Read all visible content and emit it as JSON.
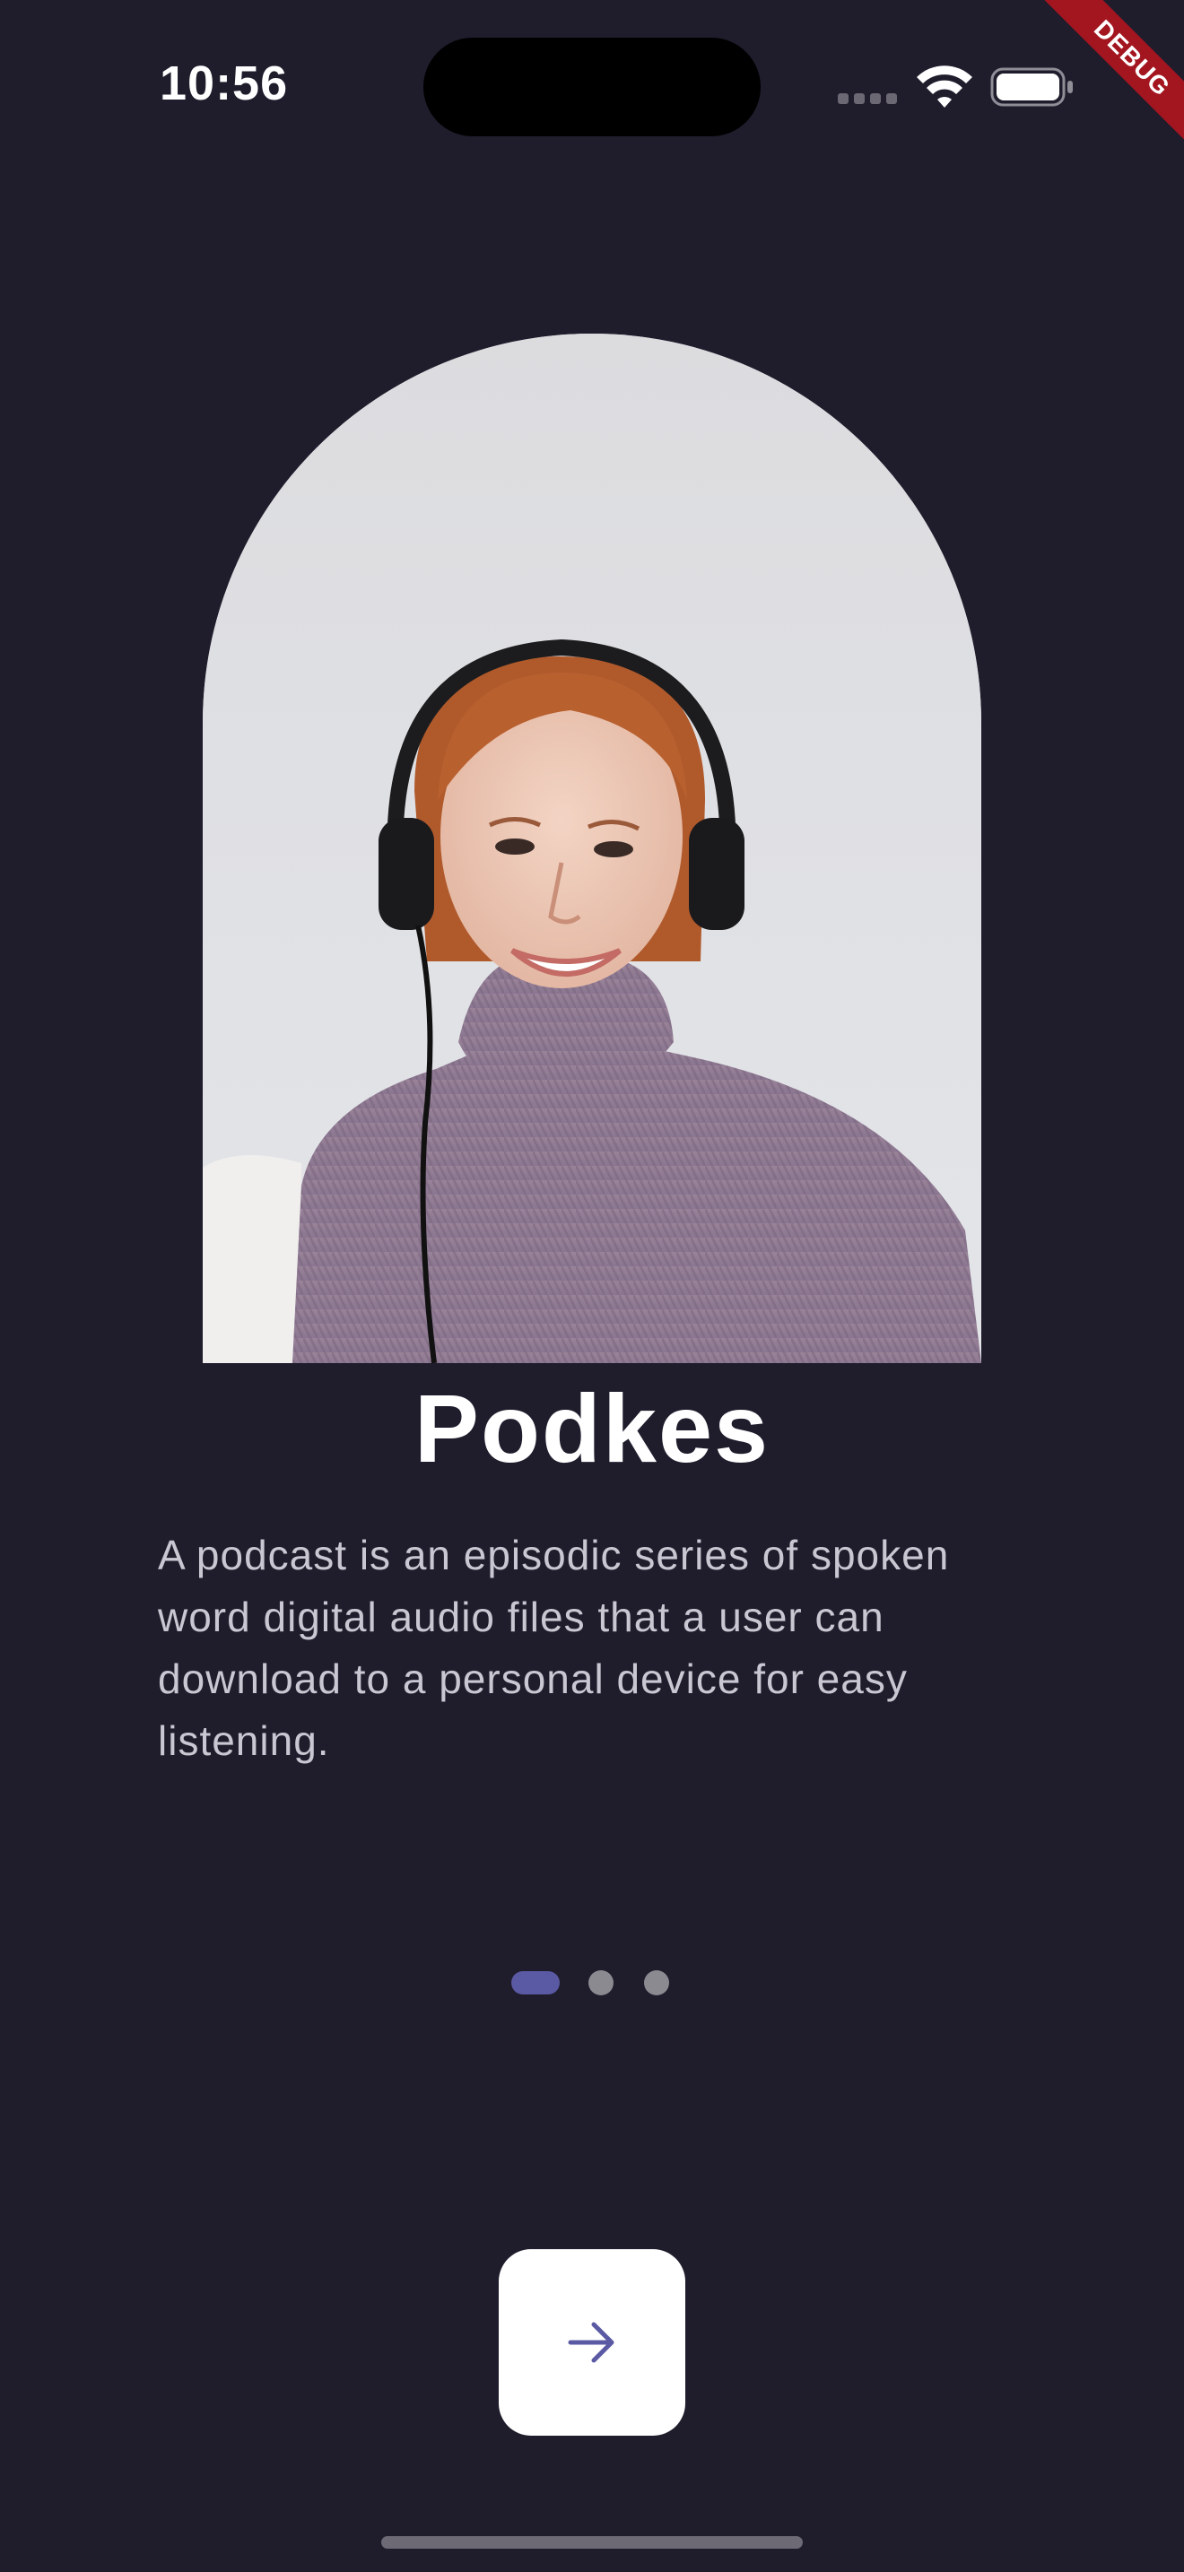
{
  "status_bar": {
    "time": "10:56",
    "signal_icon": "cellular-signal-icon",
    "wifi_icon": "wifi-icon",
    "battery_icon": "battery-icon"
  },
  "debug_banner": {
    "label": "DEBUG"
  },
  "onboarding": {
    "title": "Podkes",
    "description": "A podcast is an episodic series of spoken word digital audio files that a user can download to a personal device for easy listening.",
    "page_indicator": {
      "current_page": 1,
      "total_pages": 3
    },
    "next_button_icon": "arrow-right-icon"
  },
  "colors": {
    "background": "#1f1c2c",
    "accent": "#5a59a3",
    "text_primary": "#ffffff",
    "text_secondary": "#c9c7d1",
    "button_bg": "#ffffff"
  }
}
